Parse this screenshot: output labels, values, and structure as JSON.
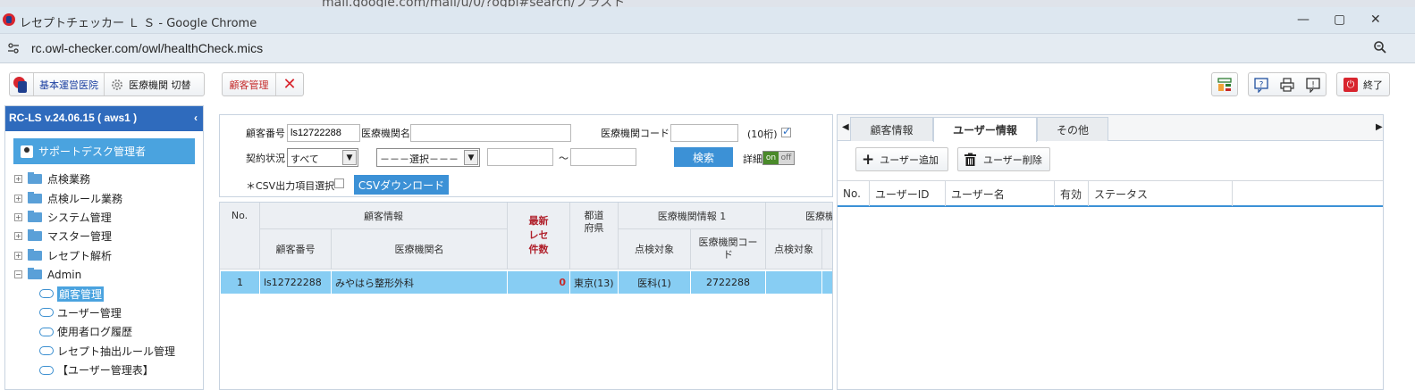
{
  "browser": {
    "behind_url": "mail.google.com/mail/u/0/?ogbl#search/ブラスト",
    "window_title": "レセプトチェッカー Ｌ Ｓ - Google Chrome",
    "url": "rc.owl-checker.com/owl/healthCheck.mics"
  },
  "toolbar": {
    "clinic_label": "基本運営医院",
    "switch_label": "医療機関 切替",
    "customer_tab": "顧客管理",
    "exit_label": "終了"
  },
  "sidebar": {
    "version": "RC-LS v.24.06.15 ( aws1 )",
    "user": "サポートデスク管理者",
    "items": [
      {
        "label": "点検業務"
      },
      {
        "label": "点検ルール業務"
      },
      {
        "label": "システム管理"
      },
      {
        "label": "マスター管理"
      },
      {
        "label": "レセプト解析"
      },
      {
        "label": "Admin"
      }
    ],
    "admin_children": [
      {
        "label": "顧客管理"
      },
      {
        "label": "ユーザー管理"
      },
      {
        "label": "使用者ログ履歴"
      },
      {
        "label": "レセプト抽出ルール管理"
      },
      {
        "label": "【ユーザー管理表】"
      }
    ]
  },
  "search": {
    "customer_no_label": "顧客番号",
    "customer_no_value": "ls12722288",
    "inst_name_label": "医療機関名",
    "inst_name_value": "",
    "inst_code_label": "医療機関コード",
    "inst_code_value": "",
    "digits_note": "(10桁)",
    "contract_label": "契約状況",
    "contract_value": "すべて",
    "select_value": "－－－選択－－－",
    "range_from": "",
    "tilde": "～",
    "range_to": "",
    "search_button": "検索",
    "detail_label": "詳細",
    "toggle_on": "on",
    "toggle_off": "off",
    "csv_label": "＊CSV出力項目選択",
    "csv_button": "CSVダウンロード"
  },
  "grid": {
    "h_no": "No.",
    "h_customer_info": "顧客情報",
    "h_latest": "最新\nレセ\n件数",
    "h_pref": "都道\n府県",
    "h_inst_info1": "医療機関情報 1",
    "h_inst_info2": "医療機",
    "h_customer_no": "顧客番号",
    "h_inst_name": "医療機関名",
    "h_check_target": "点検対象",
    "h_inst_code": "医療機関コー\nド",
    "h_check_target2": "点検対象",
    "rows": [
      {
        "no": "1",
        "customer_no": "ls12722288",
        "inst_name": "みやはら整形外科",
        "latest": "0",
        "pref": "東京(13)",
        "check_target": "医科(1)",
        "inst_code": "2722288",
        "check_target2": ""
      }
    ]
  },
  "right": {
    "tabs": [
      {
        "label": "顧客情報"
      },
      {
        "label": "ユーザー情報"
      },
      {
        "label": "その他"
      }
    ],
    "add_user": "ユーザー追加",
    "delete_user": "ユーザー削除",
    "columns": [
      {
        "label": "No."
      },
      {
        "label": "ユーザーID"
      },
      {
        "label": "ユーザー名"
      },
      {
        "label": "有効"
      },
      {
        "label": "ステータス"
      }
    ]
  }
}
